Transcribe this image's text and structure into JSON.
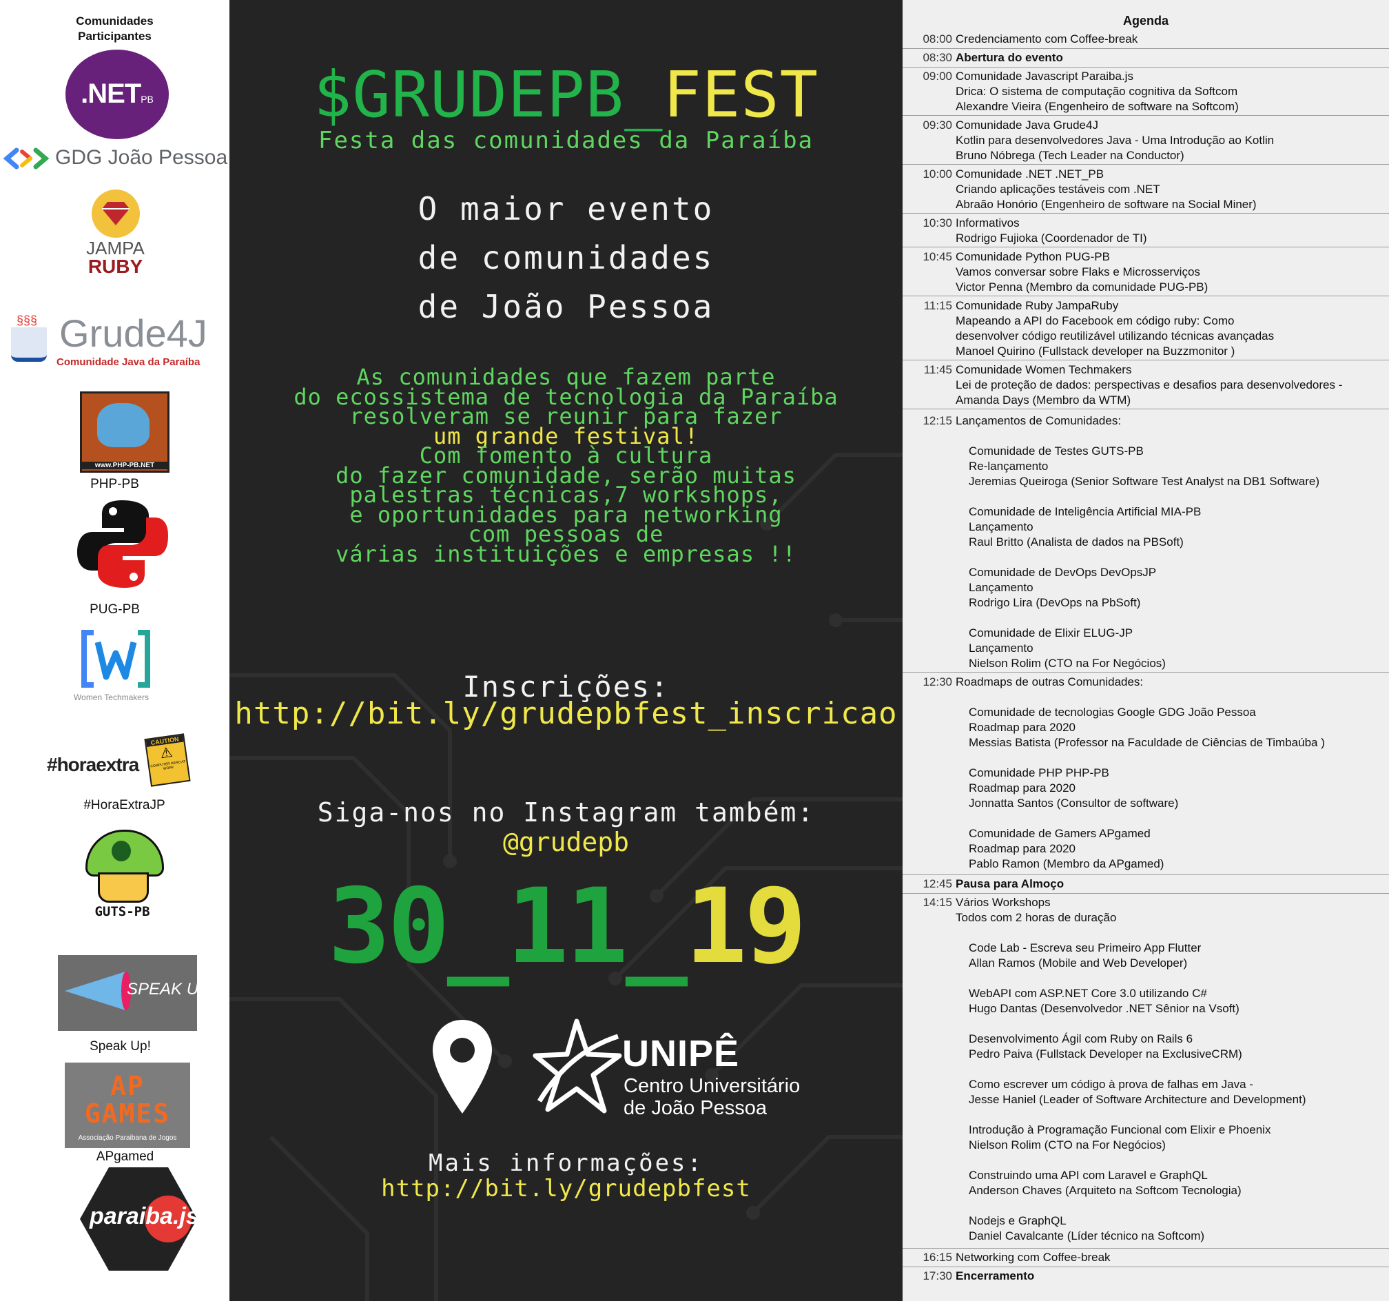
{
  "communities": {
    "title_line1": "Comunidades",
    "title_line2": "Participantes",
    "net_logo": ".NET",
    "net_logo_sub": "PB",
    "gdg_logo": "GDG João Pessoa",
    "jampa_line1": "JAMPA",
    "jampa_line2": "RUBY",
    "grude4j_logo": "Grude4J",
    "grude4j_sub": "Comunidade Java da Paraíba",
    "php_logo_text": "www.PHP-PB.NET",
    "php_label": "PHP-PB",
    "pug_label": "PUG-PB",
    "wtm_label": "Women Techmakers",
    "horaextra_logo": "#horaextra",
    "horaextra_sign_top": "CAUTION",
    "horaextra_sign_bottom": "COMPUTER NERD AT WORK",
    "horaextra_label": "#HoraExtraJP",
    "guts_logo": "GUTS-PB",
    "speakup_logo": "SPEAK UP",
    "speakup_label": "Speak Up!",
    "apgames_logo": "AP GAMES",
    "apgames_sub": "Associação Paraibana de Jogos",
    "apgames_label": "APgamed",
    "paraibajs_logo": "paraiba.js"
  },
  "event": {
    "title_prefix": "$GRUDEPB_",
    "title_suffix": "FEST",
    "subtitle": "Festa das comunidades da Paraíba",
    "headline_1": "O maior evento",
    "headline_2": "de comunidades",
    "headline_3": "de João Pessoa",
    "desc_1": "As comunidades que fazem parte",
    "desc_2": "do ecossistema de tecnologia da Paraíba",
    "desc_3": "resolveram se reunir para fazer",
    "desc_4": "um grande festival!",
    "desc_5": "Com fomento à cultura",
    "desc_6": "do fazer comunidade, serão muitas",
    "desc_7": "palestras técnicas,7 workshops,",
    "desc_8": "e oportunidades para networking",
    "desc_9": "com pessoas de",
    "desc_10": "várias instituições e empresas !!",
    "signup_label": "Inscrições:",
    "signup_url": "http://bit.ly/grudepbfest_inscricao",
    "instagram_label": "Siga-nos no Instagram também:",
    "instagram_handle": "@grudepb",
    "date_d": "30",
    "date_s1": "_",
    "date_m": "11",
    "date_s2": "_",
    "date_y": "19",
    "venue_name": "UNIPÊ",
    "venue_line1": "Centro Universitário",
    "venue_line2": "de João Pessoa",
    "more_label": "Mais informações:",
    "more_url": "http://bit.ly/grudepbfest"
  },
  "agenda": {
    "title": "Agenda",
    "items": [
      {
        "time": "08:00",
        "lines": [
          "Credenciamento com Coffee-break"
        ]
      },
      {
        "time": "08:30",
        "lines": [
          "Abertura do evento"
        ]
      },
      {
        "time": "09:00",
        "lines": [
          "Comunidade Javascript Paraiba.js",
          "Drica: O sistema de computação cognitiva da Softcom",
          "Alexandre Vieira (Engenheiro de software na Softcom)"
        ]
      },
      {
        "time": "09:30",
        "lines": [
          "Comunidade Java Grude4J",
          "Kotlin para desenvolvedores Java - Uma Introdução ao Kotlin",
          "Bruno Nóbrega (Tech Leader na Conductor)"
        ]
      },
      {
        "time": "10:00",
        "lines": [
          "Comunidade .NET .NET_PB",
          "Criando aplicações testáveis com .NET",
          "Abraão Honório (Engenheiro de software na Social Miner)"
        ]
      },
      {
        "time": "10:30",
        "lines": [
          "Informativos",
          "Rodrigo Fujioka (Coordenador de TI)"
        ]
      },
      {
        "time": "10:45",
        "lines": [
          "Comunidade Python PUG-PB",
          "Vamos conversar sobre Flaks e Microsserviços",
          "Victor Penna (Membro da comunidade PUG-PB)"
        ]
      },
      {
        "time": "11:15",
        "lines": [
          "Comunidade Ruby JampaRuby",
          "Mapeando a API do Facebook em código ruby: Como",
          "desenvolver código reutilizável utilizando técnicas avançadas",
          "Manoel Quirino (Fullstack developer na Buzzmonitor )"
        ]
      },
      {
        "time": "11:45",
        "lines": [
          "Comunidade Women Techmakers",
          "Lei de proteção de dados: perspectivas e desafios para desenvolvedores -",
          "Amanda Days (Membro da WTM)"
        ]
      },
      {
        "time": "12:15",
        "lines": [
          "Lançamentos de Comunidades:"
        ]
      },
      {
        "time": "",
        "lines": [
          "Comunidade de Testes GUTS-PB",
          "Re-lançamento",
          "Jeremias Queiroga (Senior Software Test Analyst na DB1 Software)"
        ]
      },
      {
        "time": "",
        "lines": [
          "Comunidade de Inteligência Artificial MIA-PB",
          "Lançamento",
          "Raul Britto (Analista de dados na PBSoft)"
        ]
      },
      {
        "time": "",
        "lines": [
          "Comunidade de DevOps DevOpsJP",
          "Lançamento",
          "Rodrigo Lira (DevOps na PbSoft)"
        ]
      },
      {
        "time": "",
        "lines": [
          "Comunidade de Elixir ELUG-JP",
          "Lançamento",
          "Nielson Rolim (CTO na For Negócios)"
        ]
      },
      {
        "time": "12:30",
        "lines": [
          "Roadmaps de outras Comunidades:"
        ]
      },
      {
        "time": "",
        "lines": [
          "Comunidade de tecnologias Google GDG João Pessoa",
          "Roadmap para 2020",
          "Messias Batista (Professor na Faculdade de Ciências de Timbaúba )"
        ]
      },
      {
        "time": "",
        "lines": [
          "Comunidade PHP PHP-PB",
          "Roadmap para 2020",
          "Jonnatta Santos (Consultor de software)"
        ]
      },
      {
        "time": "",
        "lines": [
          "Comunidade de Gamers APgamed",
          "Roadmap para 2020",
          "Pablo Ramon (Membro da APgamed)"
        ]
      },
      {
        "time": "12:45",
        "lines": [
          "Pausa para Almoço"
        ]
      },
      {
        "time": "14:15",
        "lines": [
          "Vários Workshops",
          "Todos com 2 horas de duração"
        ]
      },
      {
        "time": "",
        "lines": [
          "Code Lab - Escreva seu Primeiro App Flutter",
          "Allan Ramos (Mobile and Web Developer)"
        ]
      },
      {
        "time": "",
        "lines": [
          "WebAPI com ASP.NET Core 3.0 utilizando C#",
          "Hugo Dantas (Desenvolvedor .NET Sênior na Vsoft)"
        ]
      },
      {
        "time": "",
        "lines": [
          "Desenvolvimento Ágil com Ruby on Rails 6",
          "Pedro Paiva (Fullstack Developer  na ExclusiveCRM)"
        ]
      },
      {
        "time": "",
        "lines": [
          "Como escrever um código à prova de falhas em Java -",
          "Jesse Haniel (Leader of Software Architecture and Development)"
        ]
      },
      {
        "time": "",
        "lines": [
          "Introdução à Programação Funcional com Elixir e Phoenix",
          "Nielson Rolim (CTO na For Negócios)"
        ]
      },
      {
        "time": "",
        "lines": [
          "Construindo uma API com Laravel e GraphQL",
          "Anderson Chaves (Arquiteto na Softcom Tecnologia)"
        ]
      },
      {
        "time": "",
        "lines": [
          "Nodejs e GraphQL",
          "Daniel Cavalcante (Líder técnico na Softcom)"
        ]
      },
      {
        "time": "16:15",
        "lines": [
          "Networking com Coffee-break"
        ]
      },
      {
        "time": "17:30",
        "lines": [
          "Encerramento"
        ]
      }
    ]
  },
  "colors": {
    "green": "#22b34a",
    "yellow": "#e8e23a",
    "light_green": "#5cd65c",
    "background": "#242424"
  }
}
